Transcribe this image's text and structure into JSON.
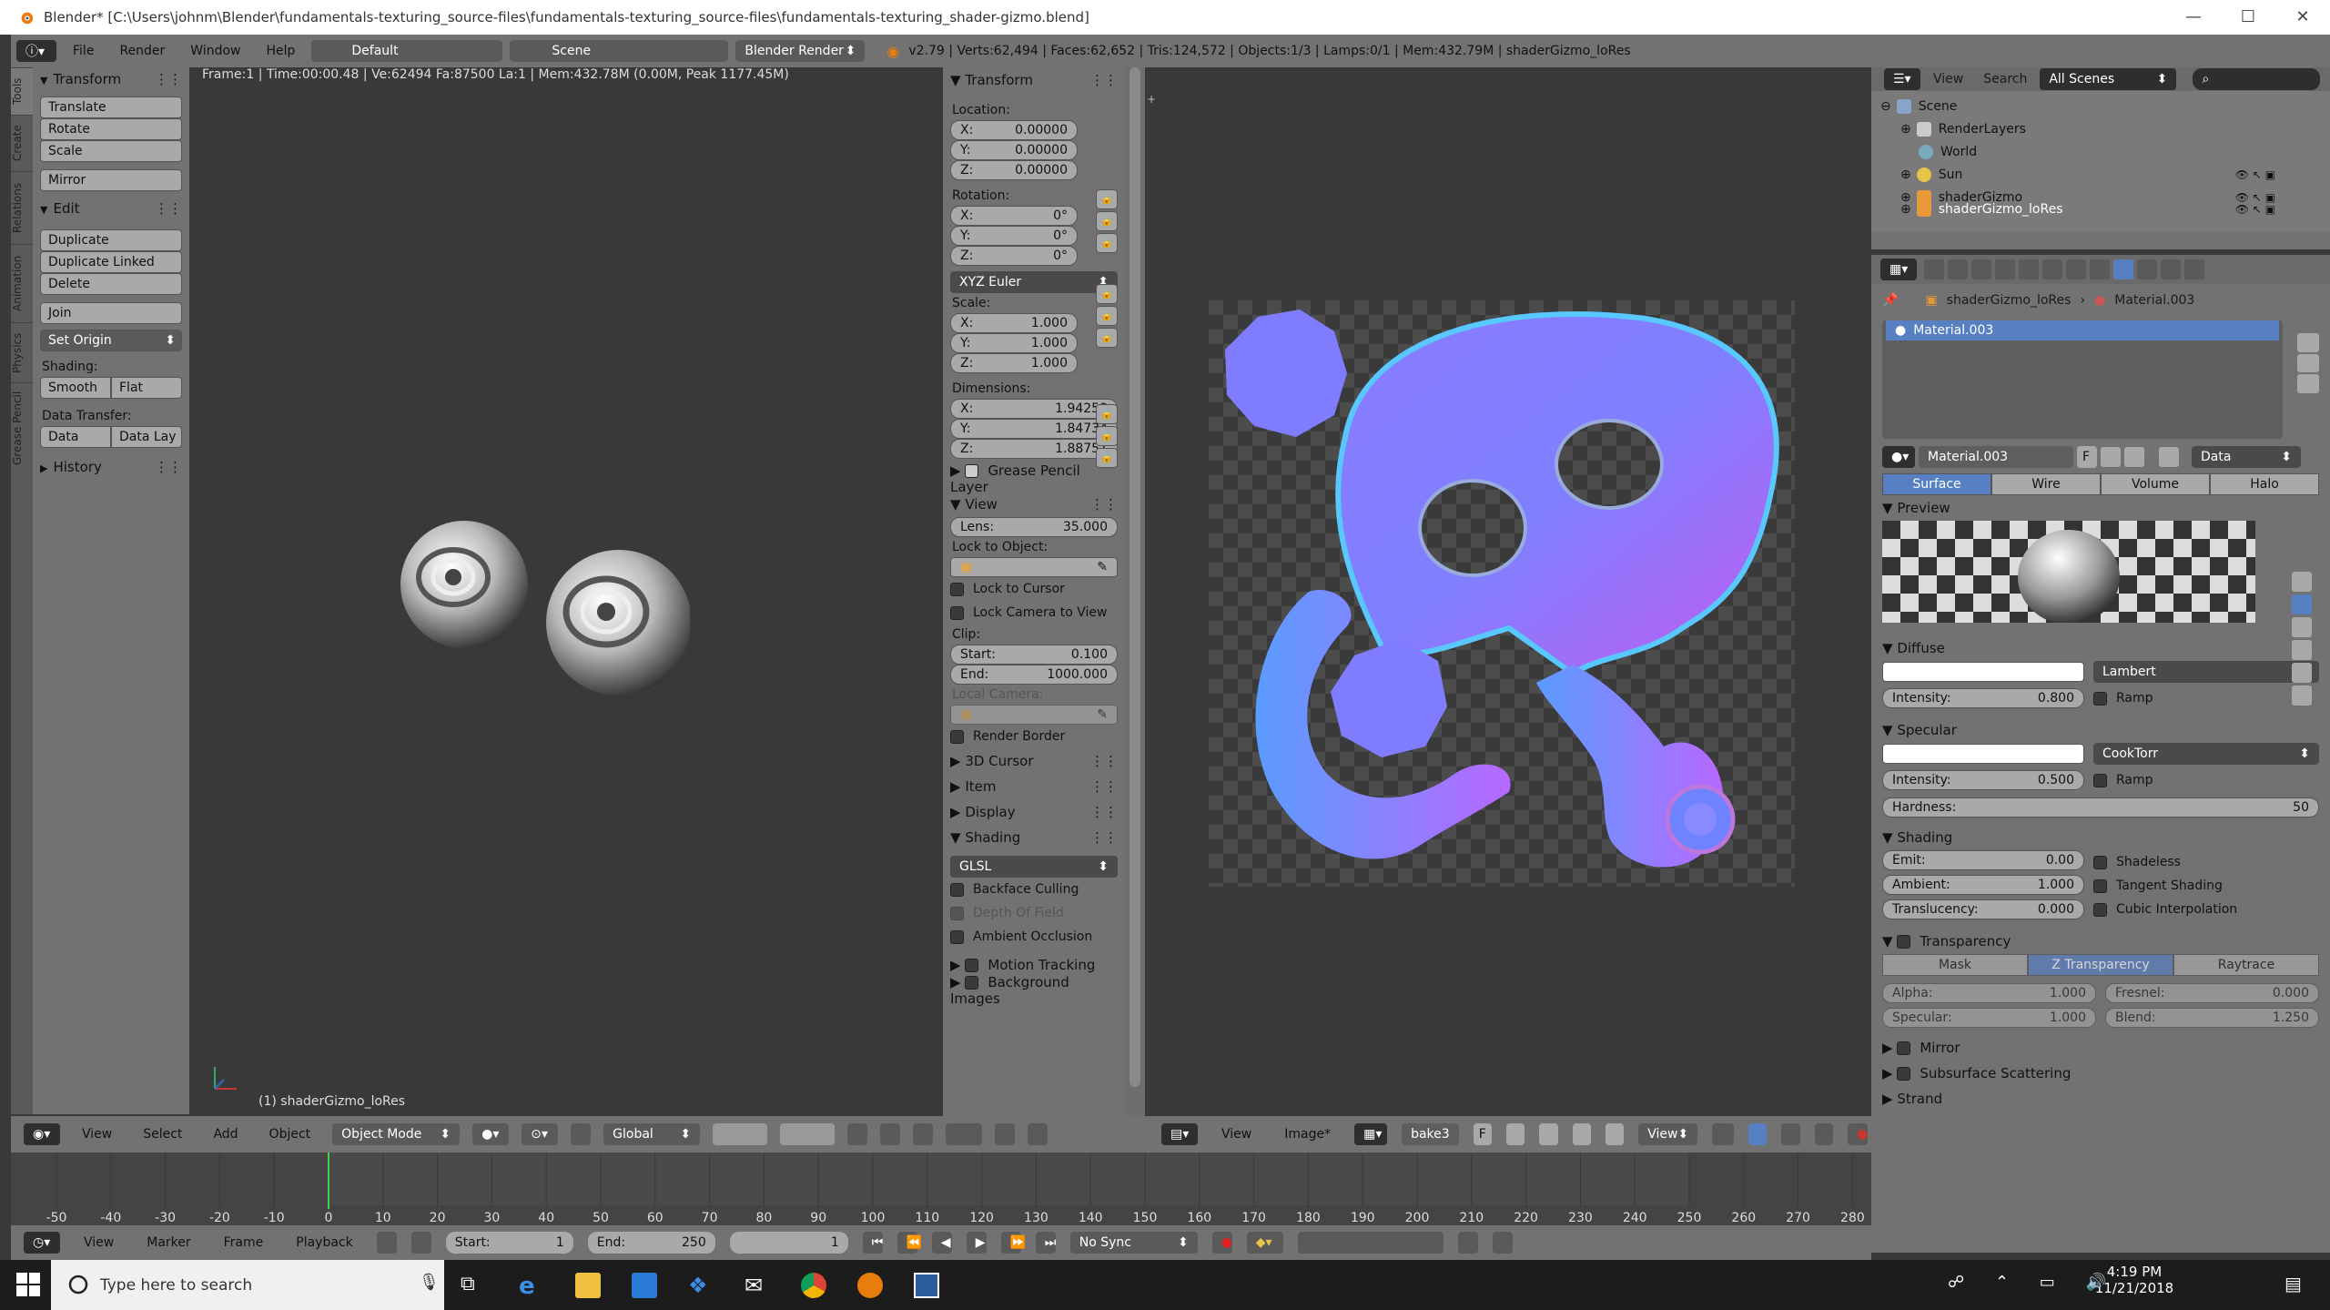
{
  "titlebar": {
    "title": "Blender* [C:\\Users\\johnm\\Blender\\fundamentals-texturing_source-files\\fundamentals-texturing_source-files\\fundamentals-texturing_shader-gizmo.blend]",
    "min": "—",
    "max": "☐",
    "close": "✕"
  },
  "infohdr": {
    "menus": [
      "File",
      "Render",
      "Window",
      "Help"
    ],
    "layout": "Default",
    "scene": "Scene",
    "engine": "Blender Render",
    "stats": "v2.79 | Verts:62,494 | Faces:62,652 | Tris:124,572 | Objects:1/3 | Lamps:0/1 | Mem:432.79M | shaderGizmo_loRes"
  },
  "lefttabs": [
    "Tools",
    "Create",
    "Relations",
    "Animation",
    "Physics",
    "Grease Pencil"
  ],
  "toolshelf": {
    "transform_title": "Transform",
    "translate": "Translate",
    "rotate": "Rotate",
    "scale": "Scale",
    "mirror": "Mirror",
    "edit_title": "Edit",
    "duplicate": "Duplicate",
    "duplicate_linked": "Duplicate Linked",
    "delete": "Delete",
    "join": "Join",
    "set_origin": "Set Origin",
    "shading_label": "Shading:",
    "smooth": "Smooth",
    "flat": "Flat",
    "data_transfer_label": "Data Transfer:",
    "data": "Data",
    "data_lay": "Data Lay",
    "history_title": "History"
  },
  "viewport": {
    "hud": "Frame:1 | Time:00:00.48 | Ve:62494 Fa:87500 La:1 | Mem:432.78M (0.00M, Peak 1177.45M)",
    "object_label": "(1) shaderGizmo_loRes"
  },
  "npanel": {
    "transform_title": "Transform",
    "location_label": "Location:",
    "loc": [
      "X:",
      "0.00000",
      "Y:",
      "0.00000",
      "Z:",
      "0.00000"
    ],
    "rotation_label": "Rotation:",
    "rot": [
      "X:",
      "0°",
      "Y:",
      "0°",
      "Z:",
      "0°"
    ],
    "rotation_mode": "XYZ Euler",
    "scale_label": "Scale:",
    "scl": [
      "X:",
      "1.000",
      "Y:",
      "1.000",
      "Z:",
      "1.000"
    ],
    "dimensions_label": "Dimensions:",
    "dim": [
      "X:",
      "1.94258",
      "Y:",
      "1.84734",
      "Z:",
      "1.88751"
    ],
    "grease_pencil": "Grease Pencil Layer",
    "view_title": "View",
    "lens_label": "Lens:",
    "lens": "35.000",
    "lock_obj_label": "Lock to Object:",
    "lock_cursor": "Lock to Cursor",
    "lock_camera": "Lock Camera to View",
    "clip_label": "Clip:",
    "start_label": "Start:",
    "start": "0.100",
    "end_label": "End:",
    "end": "1000.000",
    "local_camera": "Local Camera:",
    "render_border": "Render Border",
    "cursor_title": "3D Cursor",
    "item_title": "Item",
    "display_title": "Display",
    "shading_title": "Shading",
    "shading_mode": "GLSL",
    "backface": "Backface Culling",
    "dof": "Depth Of Field",
    "ao": "Ambient Occlusion",
    "motion_tracking": "Motion Tracking",
    "background_images": "Background Images"
  },
  "vp3dbar": {
    "view": "View",
    "select": "Select",
    "add": "Add",
    "object": "Object",
    "mode": "Object Mode",
    "orientation": "Global"
  },
  "imgbar": {
    "view": "View",
    "image": "Image*",
    "image_name": "bake",
    "users": "3",
    "fake": "F",
    "view2": "View"
  },
  "timeline": {
    "ticks": [
      "-50",
      "-40",
      "-30",
      "-20",
      "-10",
      "0",
      "10",
      "20",
      "30",
      "40",
      "50",
      "60",
      "70",
      "80",
      "90",
      "100",
      "110",
      "120",
      "130",
      "140",
      "150",
      "160",
      "170",
      "180",
      "190",
      "200",
      "210",
      "220",
      "230",
      "240",
      "250",
      "260",
      "270",
      "280"
    ],
    "current_frame": 0
  },
  "tlbar": {
    "view": "View",
    "marker": "Marker",
    "frame": "Frame",
    "playback": "Playback",
    "start_label": "Start:",
    "start": "1",
    "end_label": "End:",
    "end": "250",
    "current": "1",
    "sync": "No Sync"
  },
  "outliner": {
    "view": "View",
    "search": "Search",
    "scenes": "All Scenes",
    "rows": [
      "Scene",
      "RenderLayers",
      "World",
      "Sun",
      "shaderGizmo",
      "shaderGizmo_loRes"
    ]
  },
  "props": {
    "breadcrumb_obj": "shaderGizmo_loRes",
    "breadcrumb_mat": "Material.003",
    "slot": "Material.003",
    "mat_name": "Material.003",
    "fake": "F",
    "data": "Data",
    "tabs": [
      "Surface",
      "Wire",
      "Volume",
      "Halo"
    ],
    "preview_title": "Preview",
    "diffuse_title": "Diffuse",
    "diffuse_shader": "Lambert",
    "diffuse_int_label": "Intensity:",
    "diffuse_int": "0.800",
    "ramp": "Ramp",
    "specular_title": "Specular",
    "spec_shader": "CookTorr",
    "spec_int_label": "Intensity:",
    "spec_int": "0.500",
    "hardness_label": "Hardness:",
    "hardness": "50",
    "shading_title": "Shading",
    "emit_label": "Emit:",
    "emit": "0.00",
    "ambient_label": "Ambient:",
    "ambient": "1.000",
    "transl_label": "Translucency:",
    "transl": "0.000",
    "shadeless": "Shadeless",
    "tangent": "Tangent Shading",
    "cubic": "Cubic Interpolation",
    "transparency_title": "Transparency",
    "trans_tabs": [
      "Mask",
      "Z Transparency",
      "Raytrace"
    ],
    "alpha_label": "Alpha:",
    "alpha": "1.000",
    "fresnel_label": "Fresnel:",
    "fresnel": "0.000",
    "specular_label": "Specular:",
    "specular": "1.000",
    "blend_label": "Blend:",
    "blend": "1.250",
    "mirror_title": "Mirror",
    "sss_title": "Subsurface Scattering",
    "strand_title": "Strand"
  },
  "taskbar": {
    "search_placeholder": "Type here to search",
    "time": "4:19 PM",
    "date": "11/21/2018"
  }
}
